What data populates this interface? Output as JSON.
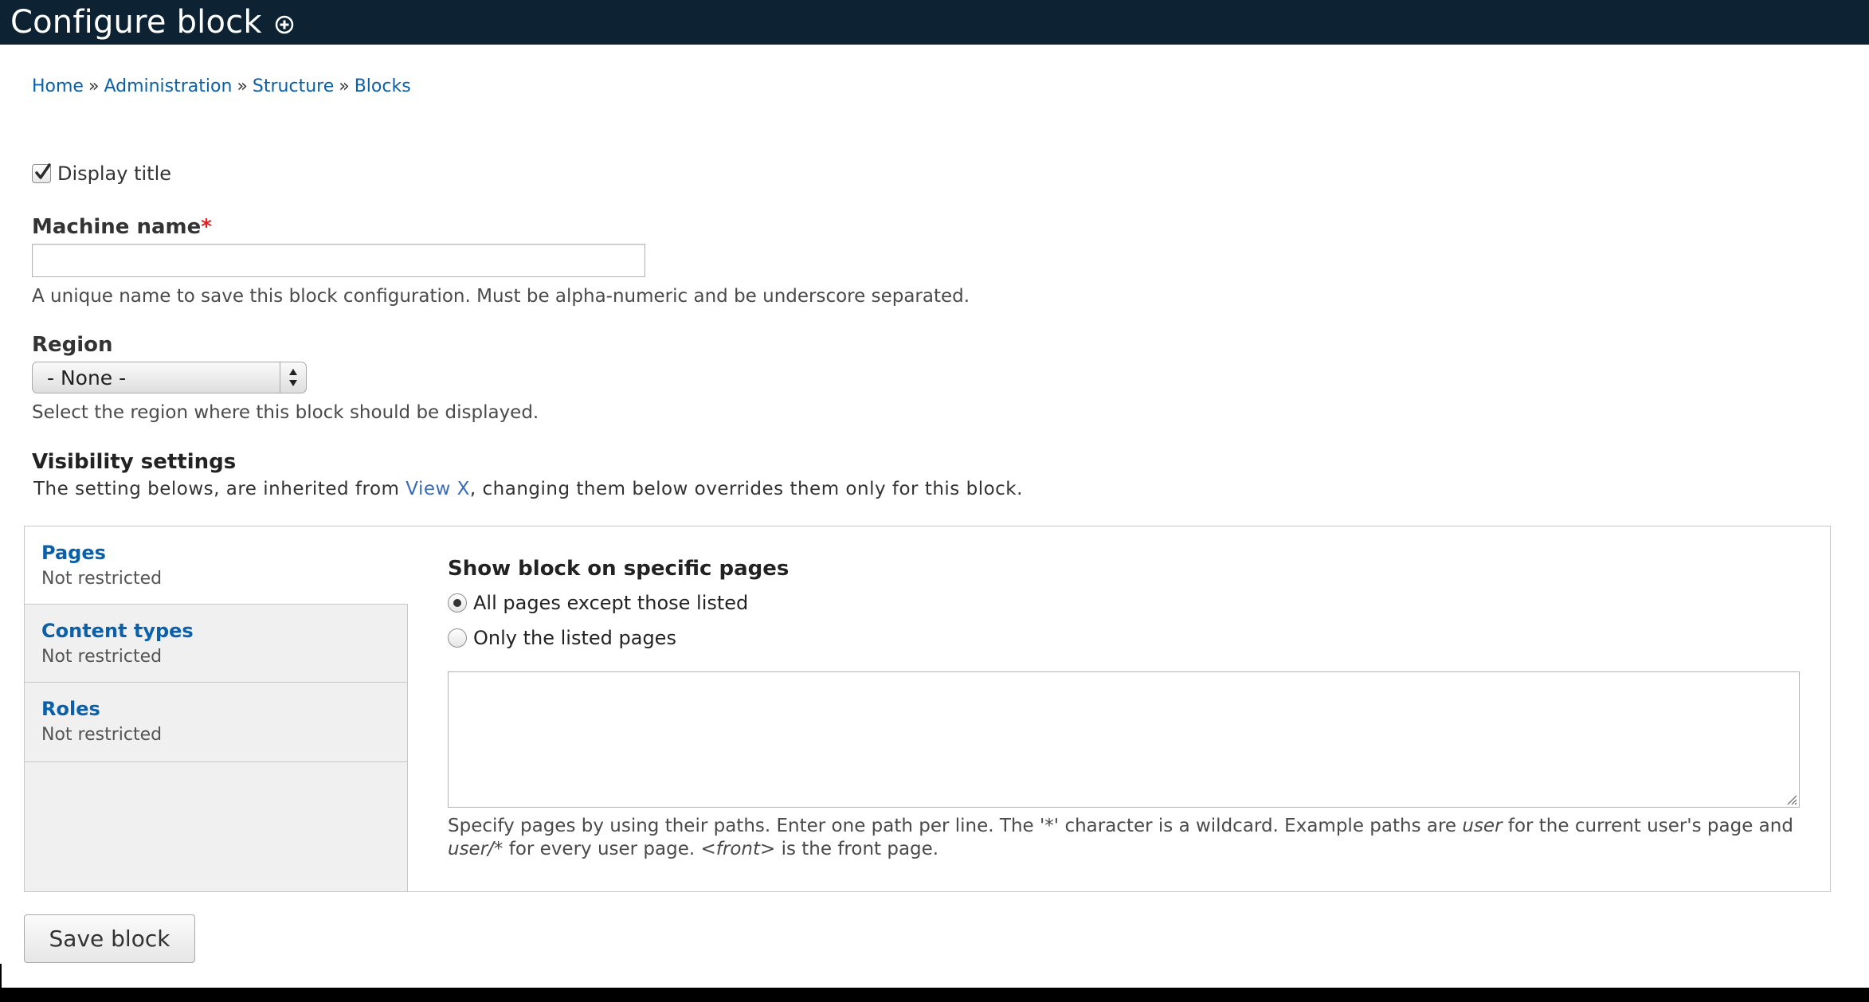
{
  "header": {
    "title": "Configure block"
  },
  "breadcrumb": {
    "items": [
      "Home",
      "Administration",
      "Structure",
      "Blocks"
    ],
    "separator": "»"
  },
  "display_title": {
    "label": "Display title",
    "checked": true
  },
  "machine_name": {
    "label": "Machine name",
    "required_marker": "*",
    "value": "",
    "description": "A unique name to save this block configuration. Must be alpha-numeric and be underscore separated."
  },
  "region": {
    "label": "Region",
    "selected": "- None -",
    "description": "Select the region where this block should be displayed."
  },
  "visibility": {
    "heading": "Visibility settings",
    "desc_before": "The setting belows, are inherited from ",
    "desc_link": "View X",
    "desc_after": ", changing them below overrides them only for this block."
  },
  "tabs": [
    {
      "title": "Pages",
      "summary": "Not restricted"
    },
    {
      "title": "Content types",
      "summary": "Not restricted"
    },
    {
      "title": "Roles",
      "summary": "Not restricted"
    }
  ],
  "pages_pane": {
    "title": "Show block on specific pages",
    "option_except": "All pages except those listed",
    "option_only": "Only the listed pages",
    "textarea_value": "",
    "help_1": "Specify pages by using their paths. Enter one path per line. The '*' character is a wildcard. Example paths are ",
    "help_user": "user",
    "help_2": " for the current user's page and ",
    "help_user_star": "user/*",
    "help_3": " for every user page. ",
    "help_front": "<front>",
    "help_4": " is the front page."
  },
  "actions": {
    "save_label": "Save block"
  },
  "colors": {
    "header_bg": "#0d2233",
    "link": "#0a61aa",
    "required": "#e02020"
  }
}
